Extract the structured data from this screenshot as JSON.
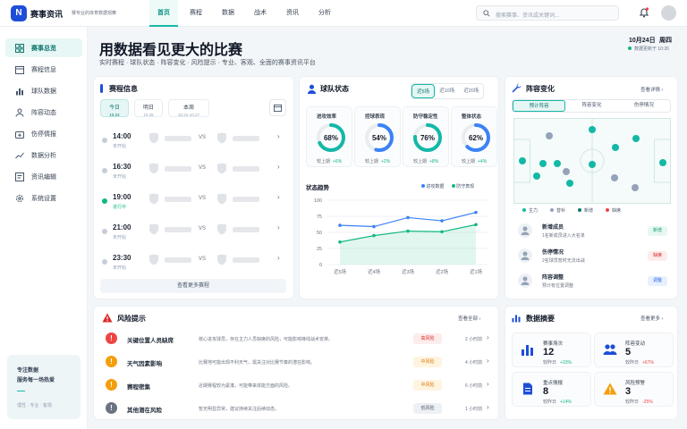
{
  "app": {
    "logo_text": "N",
    "brand": "赛事资讯",
    "slogan": "赛专业的体育数据观察"
  },
  "nav": [
    "首页",
    "赛程",
    "数据",
    "战术",
    "资讯",
    "分析"
  ],
  "search": {
    "placeholder": "搜索赛事、资讯或关键词..."
  },
  "sidebar": {
    "items": [
      {
        "label": "赛事总览",
        "icon": "grid-icon"
      },
      {
        "label": "赛程信息",
        "icon": "calendar-icon"
      },
      {
        "label": "球队数据",
        "icon": "bar-chart-icon"
      },
      {
        "label": "阵容动态",
        "icon": "users-icon"
      },
      {
        "label": "伤停情报",
        "icon": "medkit-icon"
      },
      {
        "label": "数据分析",
        "icon": "trend-icon"
      },
      {
        "label": "资讯编辑",
        "icon": "edit-icon"
      },
      {
        "label": "系统设置",
        "icon": "gear-icon"
      }
    ],
    "card": {
      "line1": "专注数据",
      "line2": "服务每一场热爱",
      "tags": "理性 · 专业 · 客观"
    }
  },
  "hero": {
    "title": "用数据看见更大的比赛",
    "subtitle": "实时赛程 · 球队状态 · 阵容变化 · 风险提示 · 专业、客观、全面的赛事资讯平台",
    "date": "10月24日",
    "weekday": "周四",
    "updated": "数据更新于 10:26"
  },
  "schedule": {
    "title": "赛程信息",
    "tabs": [
      {
        "label": "今日",
        "date": "10.24"
      },
      {
        "label": "明日",
        "date": "10.25"
      },
      {
        "label": "本周",
        "date": "10.21-10.27"
      }
    ],
    "matches": [
      {
        "time": "14:00",
        "status": "未开始",
        "live": false
      },
      {
        "time": "16:30",
        "status": "未开始",
        "live": false
      },
      {
        "time": "19:00",
        "status": "进行中",
        "live": true
      },
      {
        "time": "21:00",
        "status": "未开始",
        "live": false
      },
      {
        "time": "23:30",
        "status": "未开始",
        "live": false
      }
    ],
    "vs": "VS",
    "more": "查看更多赛程"
  },
  "team": {
    "title": "球队状态",
    "segments": [
      "近5场",
      "近10场",
      "近20场"
    ],
    "metrics": [
      {
        "label": "进攻效率",
        "value": 68,
        "pct": "68%",
        "prev_label": "较上期",
        "delta": "+6%"
      },
      {
        "label": "控球表现",
        "value": 54,
        "pct": "54%",
        "prev_label": "较上期",
        "delta": "+2%"
      },
      {
        "label": "防守稳定性",
        "value": 76,
        "pct": "76%",
        "prev_label": "较上期",
        "delta": "+8%"
      },
      {
        "label": "整体状态",
        "value": 62,
        "pct": "62%",
        "prev_label": "较上期",
        "delta": "+4%"
      }
    ],
    "trend_title": "状态趋势",
    "legend": [
      "进攻数据",
      "防守表现"
    ],
    "colors": {
      "attack": "#3b82f6",
      "defense": "#10b981",
      "teal": "#14b8a6"
    }
  },
  "chart_data": {
    "type": "line",
    "categories": [
      "近5场",
      "近4场",
      "近3场",
      "近2场",
      "近1场"
    ],
    "ylim": [
      0,
      100
    ],
    "yticks": [
      0,
      25,
      50,
      75,
      100
    ],
    "series": [
      {
        "name": "进攻数据",
        "values": [
          61,
          59,
          73,
          68,
          81
        ]
      },
      {
        "name": "防守表现",
        "values": [
          35,
          45,
          52,
          51,
          62
        ]
      }
    ]
  },
  "lineup": {
    "title": "阵容变化",
    "more": "查看详情",
    "tabs": [
      "预计阵容",
      "阵容变化",
      "伤停情况"
    ],
    "legend": [
      "主力",
      "替补",
      "新增",
      "缺席"
    ],
    "changes": [
      {
        "title": "新增成员",
        "desc": "1名新成员进入大名单",
        "badge": "新增",
        "tone": "green"
      },
      {
        "title": "伤停情况",
        "desc": "2名球员暂时无法出战",
        "badge": "缺席",
        "tone": "red"
      },
      {
        "title": "阵容调整",
        "desc": "预计有位置调整",
        "badge": "调整",
        "tone": "blue"
      }
    ]
  },
  "risk": {
    "title": "风险提示",
    "more": "查看全部",
    "items": [
      {
        "title": "关键位置人员缺席",
        "desc": "核心进攻球员，存在主力人员缺席的风险，可能影响锋线战术安排。",
        "level": "高风险",
        "time": "2 小时前",
        "icon": "!",
        "tone": "red"
      },
      {
        "title": "天气因素影响",
        "desc": "比赛地可能出现不利天气，需关注对比赛节奏的潜在影响。",
        "level": "中风险",
        "time": "4 小时前",
        "icon": "!",
        "tone": "orange"
      },
      {
        "title": "赛程密集",
        "desc": "近期赛程较为紧凑，可能带来体能方面的风险。",
        "level": "中风险",
        "time": "6 小时前",
        "icon": "!",
        "tone": "orange"
      },
      {
        "title": "其他潜在风险",
        "desc": "暂无明显异常，建议持续关注后续动态。",
        "level": "低风险",
        "time": "1 小时前",
        "icon": "!",
        "tone": "gray"
      }
    ]
  },
  "summary": {
    "title": "数据摘要",
    "more": "查看更多",
    "items": [
      {
        "label": "赛事场次",
        "value": "12",
        "cmp": "较昨日",
        "delta": "+33%",
        "tone": "green",
        "icon": "bar-chart-icon"
      },
      {
        "label": "阵容变动",
        "value": "5",
        "cmp": "较昨日",
        "delta": "+67%",
        "tone": "red",
        "icon": "users-icon"
      },
      {
        "label": "重点情报",
        "value": "8",
        "cmp": "较昨日",
        "delta": "+14%",
        "tone": "green",
        "icon": "doc-icon"
      },
      {
        "label": "风险预警",
        "value": "3",
        "cmp": "较昨日",
        "delta": "-25%",
        "tone": "red",
        "icon": "warning-icon"
      }
    ]
  }
}
